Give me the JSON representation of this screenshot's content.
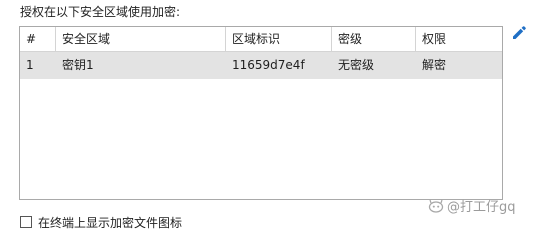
{
  "section": {
    "label": "授权在以下安全区域使用加密:"
  },
  "table": {
    "columns": [
      "#",
      "安全区域",
      "区域标识",
      "密级",
      "权限"
    ],
    "rows": [
      [
        "1",
        "密钥1",
        "11659d7e4f",
        "无密级",
        "解密"
      ]
    ]
  },
  "toolbar": {
    "edit_icon": "pencil-icon"
  },
  "options": {
    "show_icon_label": "在终端上显示加密文件图标"
  },
  "watermark": {
    "text": "@打工仔gq"
  },
  "colors": {
    "accent": "#1f6fc5",
    "selected_row": "#e3e3e3",
    "border": "#a9a9a9"
  }
}
